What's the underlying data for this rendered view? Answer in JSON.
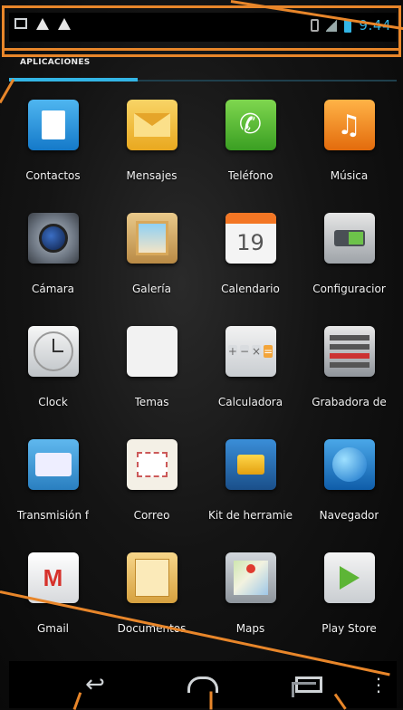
{
  "status_bar": {
    "icons_left": [
      "image-icon",
      "warning-icon",
      "warning-icon"
    ],
    "icons_right": [
      "phone-icon",
      "signal-icon",
      "battery-icon"
    ],
    "time": "9:44",
    "accent": "#33b5e5"
  },
  "tabs": {
    "active_label": "APLICACIONES"
  },
  "apps": [
    {
      "label": "Contactos",
      "icon": "contacts-icon"
    },
    {
      "label": "Mensajes",
      "icon": "messages-icon"
    },
    {
      "label": "Teléfono",
      "icon": "phone-icon"
    },
    {
      "label": "Música",
      "icon": "music-icon"
    },
    {
      "label": "Cámara",
      "icon": "camera-icon"
    },
    {
      "label": "Galería",
      "icon": "gallery-icon"
    },
    {
      "label": "Calendario",
      "icon": "calendar-icon"
    },
    {
      "label": "Configuracior",
      "icon": "settings-icon"
    },
    {
      "label": "Clock",
      "icon": "clock-icon"
    },
    {
      "label": "Temas",
      "icon": "themes-icon"
    },
    {
      "label": "Calculadora",
      "icon": "calculator-icon"
    },
    {
      "label": "Grabadora de",
      "icon": "recorder-icon"
    },
    {
      "label": "Transmisión f",
      "icon": "radio-icon"
    },
    {
      "label": "Correo",
      "icon": "mail-icon"
    },
    {
      "label": "Kit de herramie",
      "icon": "sim-toolkit-icon"
    },
    {
      "label": "Navegador",
      "icon": "browser-icon"
    },
    {
      "label": "Gmail",
      "icon": "gmail-icon"
    },
    {
      "label": "Documentos",
      "icon": "documents-icon"
    },
    {
      "label": "Maps",
      "icon": "maps-icon"
    },
    {
      "label": "Play Store",
      "icon": "play-store-icon"
    }
  ],
  "calendar_day": "19",
  "gmail_letter": "M",
  "nav_bar": {
    "buttons": [
      "back-icon",
      "home-icon",
      "recents-icon",
      "menu-icon"
    ],
    "menu_glyph": "⋮"
  },
  "annotation_color": "#e8862a"
}
